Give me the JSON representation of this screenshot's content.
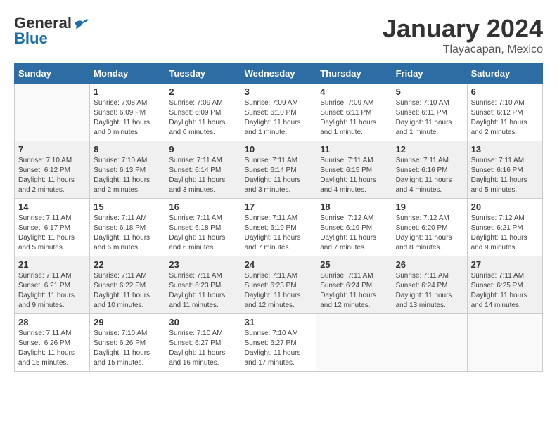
{
  "logo": {
    "text_general": "General",
    "text_blue": "Blue"
  },
  "header": {
    "month": "January 2024",
    "location": "Tlayacapan, Mexico"
  },
  "weekdays": [
    "Sunday",
    "Monday",
    "Tuesday",
    "Wednesday",
    "Thursday",
    "Friday",
    "Saturday"
  ],
  "weeks": [
    [
      {
        "day": "",
        "info": ""
      },
      {
        "day": "1",
        "info": "Sunrise: 7:08 AM\nSunset: 6:09 PM\nDaylight: 11 hours\nand 0 minutes."
      },
      {
        "day": "2",
        "info": "Sunrise: 7:09 AM\nSunset: 6:09 PM\nDaylight: 11 hours\nand 0 minutes."
      },
      {
        "day": "3",
        "info": "Sunrise: 7:09 AM\nSunset: 6:10 PM\nDaylight: 11 hours\nand 1 minute."
      },
      {
        "day": "4",
        "info": "Sunrise: 7:09 AM\nSunset: 6:11 PM\nDaylight: 11 hours\nand 1 minute."
      },
      {
        "day": "5",
        "info": "Sunrise: 7:10 AM\nSunset: 6:11 PM\nDaylight: 11 hours\nand 1 minute."
      },
      {
        "day": "6",
        "info": "Sunrise: 7:10 AM\nSunset: 6:12 PM\nDaylight: 11 hours\nand 2 minutes."
      }
    ],
    [
      {
        "day": "7",
        "info": "Sunrise: 7:10 AM\nSunset: 6:12 PM\nDaylight: 11 hours\nand 2 minutes."
      },
      {
        "day": "8",
        "info": "Sunrise: 7:10 AM\nSunset: 6:13 PM\nDaylight: 11 hours\nand 2 minutes."
      },
      {
        "day": "9",
        "info": "Sunrise: 7:11 AM\nSunset: 6:14 PM\nDaylight: 11 hours\nand 3 minutes."
      },
      {
        "day": "10",
        "info": "Sunrise: 7:11 AM\nSunset: 6:14 PM\nDaylight: 11 hours\nand 3 minutes."
      },
      {
        "day": "11",
        "info": "Sunrise: 7:11 AM\nSunset: 6:15 PM\nDaylight: 11 hours\nand 4 minutes."
      },
      {
        "day": "12",
        "info": "Sunrise: 7:11 AM\nSunset: 6:16 PM\nDaylight: 11 hours\nand 4 minutes."
      },
      {
        "day": "13",
        "info": "Sunrise: 7:11 AM\nSunset: 6:16 PM\nDaylight: 11 hours\nand 5 minutes."
      }
    ],
    [
      {
        "day": "14",
        "info": "Sunrise: 7:11 AM\nSunset: 6:17 PM\nDaylight: 11 hours\nand 5 minutes."
      },
      {
        "day": "15",
        "info": "Sunrise: 7:11 AM\nSunset: 6:18 PM\nDaylight: 11 hours\nand 6 minutes."
      },
      {
        "day": "16",
        "info": "Sunrise: 7:11 AM\nSunset: 6:18 PM\nDaylight: 11 hours\nand 6 minutes."
      },
      {
        "day": "17",
        "info": "Sunrise: 7:11 AM\nSunset: 6:19 PM\nDaylight: 11 hours\nand 7 minutes."
      },
      {
        "day": "18",
        "info": "Sunrise: 7:12 AM\nSunset: 6:19 PM\nDaylight: 11 hours\nand 7 minutes."
      },
      {
        "day": "19",
        "info": "Sunrise: 7:12 AM\nSunset: 6:20 PM\nDaylight: 11 hours\nand 8 minutes."
      },
      {
        "day": "20",
        "info": "Sunrise: 7:12 AM\nSunset: 6:21 PM\nDaylight: 11 hours\nand 9 minutes."
      }
    ],
    [
      {
        "day": "21",
        "info": "Sunrise: 7:11 AM\nSunset: 6:21 PM\nDaylight: 11 hours\nand 9 minutes."
      },
      {
        "day": "22",
        "info": "Sunrise: 7:11 AM\nSunset: 6:22 PM\nDaylight: 11 hours\nand 10 minutes."
      },
      {
        "day": "23",
        "info": "Sunrise: 7:11 AM\nSunset: 6:23 PM\nDaylight: 11 hours\nand 11 minutes."
      },
      {
        "day": "24",
        "info": "Sunrise: 7:11 AM\nSunset: 6:23 PM\nDaylight: 11 hours\nand 12 minutes."
      },
      {
        "day": "25",
        "info": "Sunrise: 7:11 AM\nSunset: 6:24 PM\nDaylight: 11 hours\nand 12 minutes."
      },
      {
        "day": "26",
        "info": "Sunrise: 7:11 AM\nSunset: 6:24 PM\nDaylight: 11 hours\nand 13 minutes."
      },
      {
        "day": "27",
        "info": "Sunrise: 7:11 AM\nSunset: 6:25 PM\nDaylight: 11 hours\nand 14 minutes."
      }
    ],
    [
      {
        "day": "28",
        "info": "Sunrise: 7:11 AM\nSunset: 6:26 PM\nDaylight: 11 hours\nand 15 minutes."
      },
      {
        "day": "29",
        "info": "Sunrise: 7:10 AM\nSunset: 6:26 PM\nDaylight: 11 hours\nand 15 minutes."
      },
      {
        "day": "30",
        "info": "Sunrise: 7:10 AM\nSunset: 6:27 PM\nDaylight: 11 hours\nand 16 minutes."
      },
      {
        "day": "31",
        "info": "Sunrise: 7:10 AM\nSunset: 6:27 PM\nDaylight: 11 hours\nand 17 minutes."
      },
      {
        "day": "",
        "info": ""
      },
      {
        "day": "",
        "info": ""
      },
      {
        "day": "",
        "info": ""
      }
    ]
  ]
}
